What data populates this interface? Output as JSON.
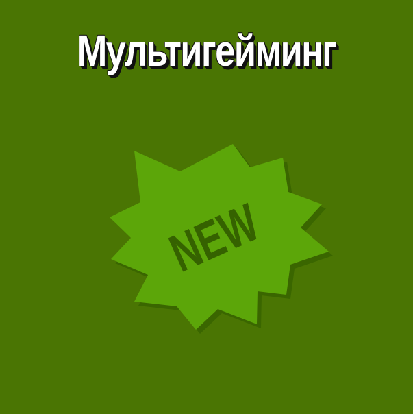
{
  "colors": {
    "background": "#4a7503",
    "burst_fill": "#5ca609",
    "burst_shadow": "#3a6600",
    "badge_text": "#356200",
    "title_fill": "#ffffff",
    "title_outline": "#111111"
  },
  "title": "Мультигейминг",
  "badge": {
    "icon": "starburst-new-badge",
    "text": "NEW"
  }
}
